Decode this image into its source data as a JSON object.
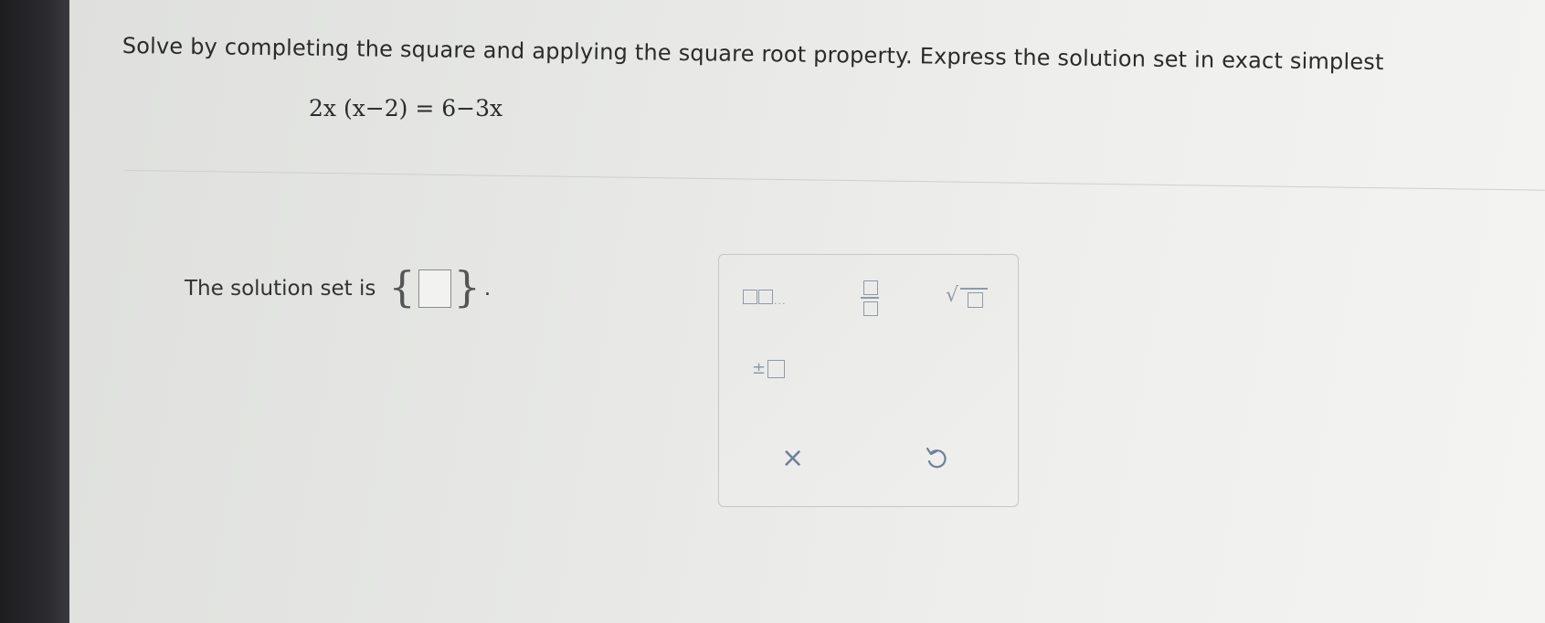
{
  "question": {
    "text": "Solve by completing the square and applying the square root property. Express the solution set in exact simplest"
  },
  "equation": {
    "text": "2x (x−2) = 6−3x"
  },
  "answer": {
    "label": "The solution set is",
    "period": "."
  },
  "palette": {
    "tools": [
      "mixed-number",
      "fraction",
      "square-root",
      "plus-minus"
    ],
    "clear_symbol": "×",
    "accent_color": "#8f99a8"
  }
}
